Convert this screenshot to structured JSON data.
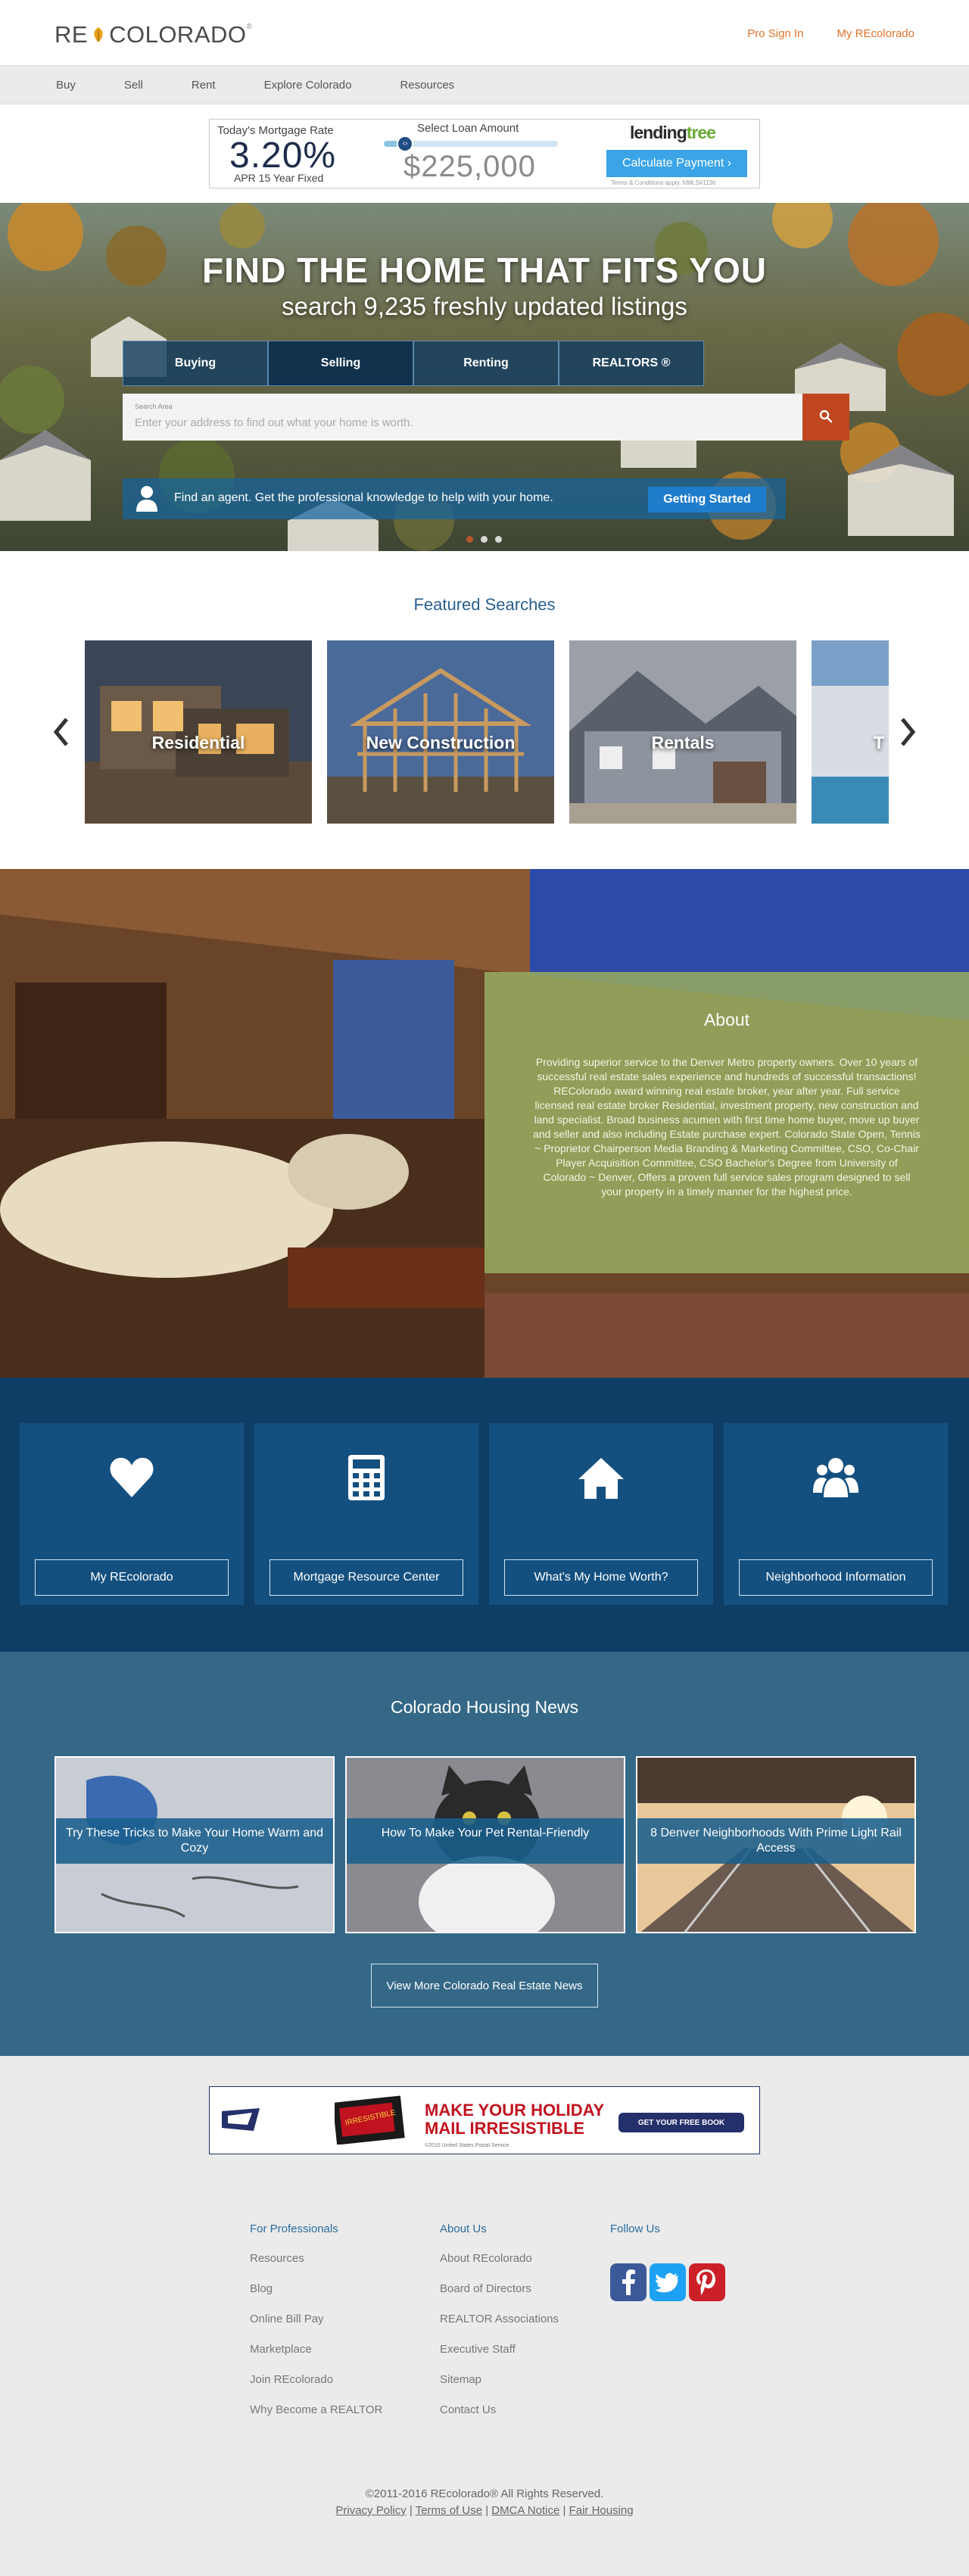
{
  "header": {
    "logo_text_left": "RE",
    "logo_text_right": "COLORADO",
    "logo_reg": "®",
    "pro_sign_in": "Pro Sign In",
    "my_recolorado": "My REcolorado"
  },
  "nav": {
    "items": [
      {
        "label": "Buy"
      },
      {
        "label": "Sell"
      },
      {
        "label": "Rent"
      },
      {
        "label": "Explore Colorado"
      },
      {
        "label": "Resources"
      }
    ]
  },
  "mortgage_ad": {
    "rate_title": "Today's Mortgage Rate",
    "rate": "3.20%",
    "rate_sub": "APR 15 Year Fixed",
    "loan_label": "Select Loan Amount",
    "loan_amount": "$225,000",
    "slider_fraction": 0.12,
    "brand_left": "lending",
    "brand_right": "tree",
    "calculate_button": "Calculate Payment  ›",
    "terms": "Terms & Conditions apply. NMLS#1136"
  },
  "hero": {
    "title": "FIND THE HOME THAT FITS YOU",
    "subtitle": "search 9,235 freshly updated listings",
    "tabs": [
      {
        "label": "Buying"
      },
      {
        "label": "Selling"
      },
      {
        "label": "Renting"
      },
      {
        "label": "REALTORS ®"
      }
    ],
    "active_tab": 1,
    "search_label": "Search Area",
    "search_placeholder": "Enter your address to find out what your home is worth.",
    "agent_text": "Find an agent. Get the professional knowledge to help with your home.",
    "agent_button": "Getting Started",
    "slide_count": 3,
    "active_slide": 0
  },
  "featured": {
    "title": "Featured Searches",
    "cards": [
      {
        "label": "Residential"
      },
      {
        "label": "New Construction"
      },
      {
        "label": "Rentals"
      },
      {
        "label": "T"
      }
    ]
  },
  "about": {
    "title": "About",
    "body": "Providing superior service to the Denver Metro property owners. Over 10 years of successful real estate sales experience and hundreds of successful transactions! REColorado award winning real estate broker, year after year. Full service licensed real estate broker Residential, investment property, new construction and land specialist. Broad business acumen with first time home buyer, move up buyer and seller and also including Estate purchase expert. Colorado State Open, Tennis ~ Proprietor Chairperson Media Branding & Marketing Committee, CSO, Co-Chair Player Acquisition Committee, CSO Bachelor's Degree from University of Colorado ~ Denver, Offers a proven full service sales program designed to sell your property in a timely manner for the highest price."
  },
  "quick_links": [
    {
      "label": "My REcolorado",
      "icon": "heart-icon"
    },
    {
      "label": "Mortgage Resource Center",
      "icon": "calculator-icon"
    },
    {
      "label": "What's My Home Worth?",
      "icon": "house-icon"
    },
    {
      "label": "Neighborhood Information",
      "icon": "people-icon"
    }
  ],
  "news": {
    "title": "Colorado Housing News",
    "cards": [
      {
        "caption": "Try These Tricks to Make Your Home Warm and Cozy"
      },
      {
        "caption": "How To Make Your Pet Rental-Friendly"
      },
      {
        "caption": "8 Denver Neighborhoods With Prime Light Rail Access"
      }
    ],
    "more_button": "View More Colorado Real Estate News"
  },
  "usps_ad": {
    "stamp_text": "IRRESISTIBLE",
    "line1": "MAKE YOUR HOLIDAY",
    "line2": "MAIL IRRESISTIBLE",
    "small": "©2015 United States Postal Service",
    "button": "GET YOUR FREE BOOK"
  },
  "footer": {
    "col1": [
      {
        "label": "For Professionals",
        "heading": true
      },
      {
        "label": "Resources"
      },
      {
        "label": "Blog"
      },
      {
        "label": "Online Bill Pay"
      },
      {
        "label": "Marketplace"
      },
      {
        "label": "Join REcolorado"
      },
      {
        "label": "Why Become a REALTOR"
      }
    ],
    "col2": [
      {
        "label": "About Us",
        "heading": true
      },
      {
        "label": "About REcolorado"
      },
      {
        "label": "Board of Directors"
      },
      {
        "label": "REALTOR Associations"
      },
      {
        "label": "Executive Staff"
      },
      {
        "label": "Sitemap"
      },
      {
        "label": "Contact Us"
      }
    ],
    "follow_us": "Follow Us",
    "social": [
      {
        "name": "facebook-icon",
        "color": "#3b5998"
      },
      {
        "name": "twitter-icon",
        "color": "#1da1f2"
      },
      {
        "name": "pinterest-icon",
        "color": "#cb2027"
      }
    ],
    "copyright": "©2011-2016 REcolorado® All Rights Reserved.",
    "legal_links": [
      {
        "label": "Privacy Policy"
      },
      {
        "label": "Terms of Use"
      },
      {
        "label": "DMCA Notice"
      },
      {
        "label": "Fair Housing"
      }
    ]
  }
}
